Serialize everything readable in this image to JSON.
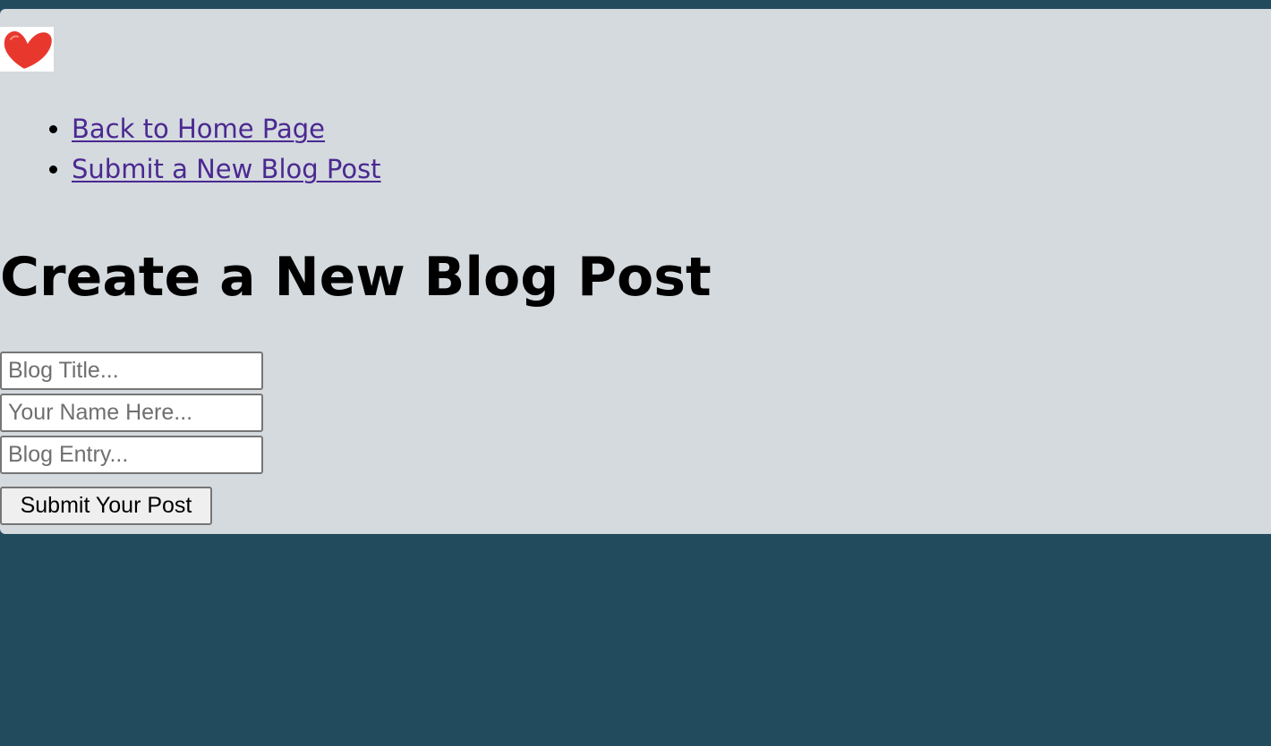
{
  "nav": {
    "items": [
      {
        "label": "Back to Home Page"
      },
      {
        "label": "Submit a New Blog Post"
      }
    ]
  },
  "page": {
    "title": "Create a New Blog Post"
  },
  "form": {
    "title_placeholder": "Blog Title...",
    "name_placeholder": "Your Name Here...",
    "entry_placeholder": "Blog Entry...",
    "submit_label": "Submit Your Post"
  },
  "icons": {
    "logo": "heart-icon"
  },
  "colors": {
    "background": "#224b5e",
    "panel": "#d4dade",
    "link": "#4b2891",
    "heart": "#e8382e"
  }
}
